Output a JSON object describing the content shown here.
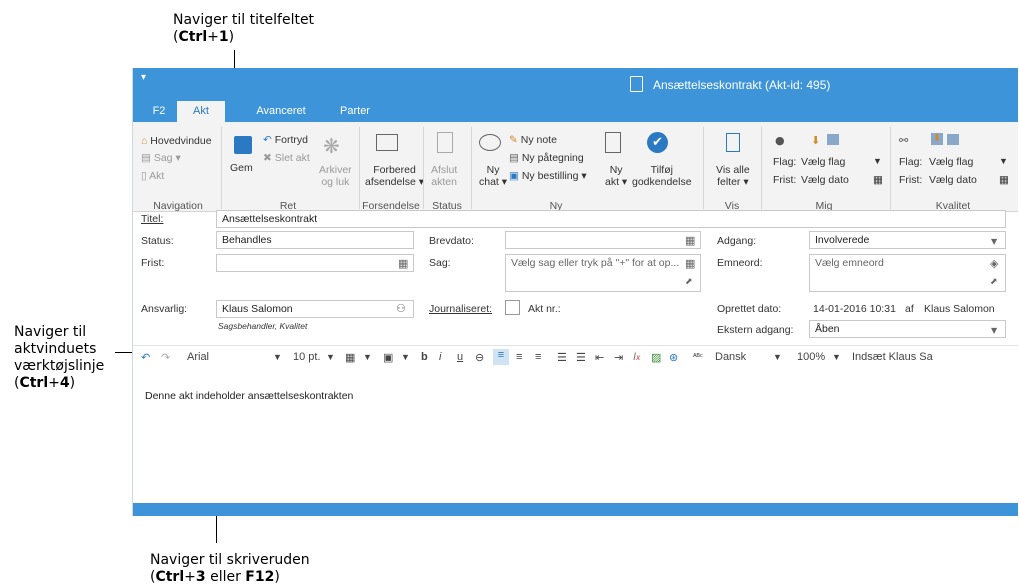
{
  "callouts": {
    "top_line1": "Naviger til titelfeltet",
    "top_paren_open": "(",
    "top_key1": "Ctrl",
    "top_plus": "+",
    "top_key2": "1",
    "top_paren_close": ")",
    "left_line1": "Naviger til",
    "left_line2": "aktvinduets",
    "left_line3": "værktøjslinje",
    "left_paren_open": "(",
    "left_key1": "Ctrl",
    "left_plus": "+",
    "left_key2": "4",
    "left_paren_close": ")",
    "bottom_line1": "Naviger til skriveruden",
    "bottom_paren_open": "(",
    "bottom_key1": "Ctrl",
    "bottom_plus": "+",
    "bottom_key2": "3",
    "bottom_or": " eller ",
    "bottom_key3": "F12",
    "bottom_paren_close": ")"
  },
  "window": {
    "title": "Ansættelseskontrakt (Akt-id: 495)",
    "quick_access": "▾"
  },
  "tabs": [
    "F2",
    "Akt",
    "Avanceret",
    "Parter"
  ],
  "ribbon": {
    "navigation": {
      "hovedvindue": "Hovedvindue",
      "sag": "Sag",
      "akt": "Akt",
      "group": "Navigation"
    },
    "ret": {
      "gem": "Gem",
      "fortryd": "Fortryd",
      "slet_akt": "Slet akt",
      "arkiver1": "Arkiver",
      "arkiver2": "og luk",
      "group": "Ret"
    },
    "forsendelse": {
      "label1": "Forbered",
      "label2": "afsendelse",
      "group": "Forsendelse"
    },
    "status": {
      "label1": "Afslut",
      "label2": "akten",
      "group": "Status"
    },
    "ny": {
      "ny_chat1": "Ny",
      "ny_chat2": "chat",
      "ny_note": "Ny note",
      "ny_paategning": "Ny påtegning",
      "ny_bestilling": "Ny bestilling",
      "ny_akt1": "Ny",
      "ny_akt2": "akt",
      "tilfoej1": "Tilføj",
      "tilfoej2": "godkendelse",
      "group": "Ny"
    },
    "vis": {
      "label1": "Vis alle",
      "label2": "felter",
      "group": "Vis"
    },
    "mig": {
      "flag_label": "Flag:",
      "flag_value": "Vælg flag",
      "frist_label": "Frist:",
      "frist_value": "Vælg dato",
      "group": "Mig"
    },
    "kvalitet": {
      "flag_label": "Flag:",
      "flag_value": "Vælg flag",
      "frist_label": "Frist:",
      "frist_value": "Vælg dato",
      "group": "Kvalitet"
    }
  },
  "form": {
    "titel_label": "Titel:",
    "titel_value": "Ansættelseskontrakt",
    "status_label": "Status:",
    "status_value": "Behandles",
    "frist_label": "Frist:",
    "frist_value": "",
    "ansvarlig_label": "Ansvarlig:",
    "ansvarlig_value": "Klaus Salomon",
    "ansvarlig_sub": "Sagsbehandler, Kvalitet",
    "brevdato_label": "Brevdato:",
    "brevdato_value": "",
    "sag_label": "Sag:",
    "sag_placeholder": "Vælg sag eller tryk på \"+\" for at op...",
    "journaliseret_label": "Journaliseret:",
    "aktnr_label": "Akt nr.:",
    "adgang_label": "Adgang:",
    "adgang_value": "Involverede",
    "emneord_label": "Emneord:",
    "emneord_placeholder": "Vælg emneord",
    "oprettet_label": "Oprettet dato:",
    "oprettet_value": "14-01-2016 10:31",
    "oprettet_af": "af",
    "oprettet_by": "Klaus Salomon",
    "ekstern_label": "Ekstern adgang:",
    "ekstern_value": "Åben"
  },
  "toolbar": {
    "font": "Arial",
    "size": "10 pt.",
    "language": "Dansk",
    "zoom": "100%",
    "insert": "Indsæt Klaus Sa"
  },
  "body_text": "Denne akt indeholder ansættelseskontrakten",
  "colors": {
    "accent": "#3d94d8",
    "ribbon_bg": "#f3f3f3"
  }
}
